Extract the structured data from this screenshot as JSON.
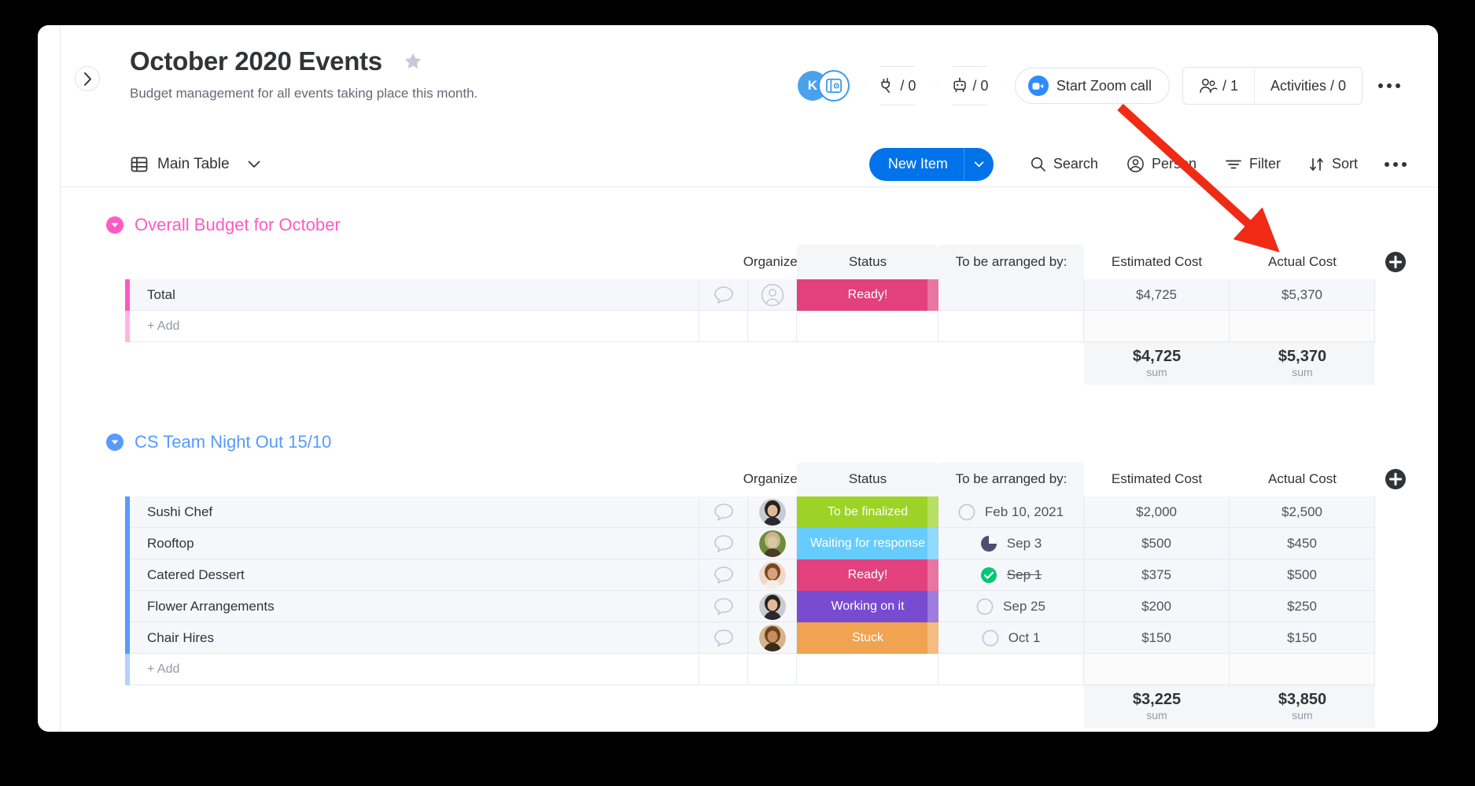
{
  "window": {
    "board_title": "October 2020 Events",
    "board_description": "Budget management for all events taking place this month.",
    "sidebar_toggle": "›"
  },
  "top_actions": {
    "avatar_initial": "K",
    "integrations_count": "/ 0",
    "automations_count": "/ 0",
    "zoom_call_label": "Start Zoom call",
    "people_count": "/ 1",
    "activities_label": "Activities / 0"
  },
  "toolbar": {
    "view_label": "Main Table",
    "new_item_label": "New Item",
    "search_label": "Search",
    "person_label": "Person",
    "filter_label": "Filter",
    "sort_label": "Sort"
  },
  "columns": {
    "name": "",
    "organizer": "Organizer",
    "status": "Status",
    "date": "To be arranged by:",
    "estimated": "Estimated Cost",
    "actual": "Actual Cost"
  },
  "add_row_label": "+ Add",
  "sum_label": "sum",
  "status_colors": {
    "ready": "#e2417e",
    "to_be_finalized": "#9cd326",
    "waiting_for_response": "#66ccff",
    "working_on_it": "#784bd1",
    "stuck": "#f0a350"
  },
  "groups": [
    {
      "name": "Overall Budget for October",
      "color": "#ff5ac4",
      "rows": [
        {
          "name": "Total",
          "organizer": "",
          "status": "Ready!",
          "status_key": "ready",
          "date": "",
          "date_state": "none",
          "estimated": "$4,725",
          "actual": "$5,370"
        }
      ],
      "sum_estimated": "$4,725",
      "sum_actual": "$5,370"
    },
    {
      "name": "CS Team Night Out 15/10",
      "color": "#579bfc",
      "rows": [
        {
          "name": "Sushi Chef",
          "organizer": "woman-dark-hair",
          "status": "To be finalized",
          "status_key": "to_be_finalized",
          "date": "Feb 10, 2021",
          "date_state": "empty",
          "estimated": "$2,000",
          "actual": "$2,500"
        },
        {
          "name": "Rooftop",
          "organizer": "pug-dog",
          "status": "Waiting for response",
          "status_key": "waiting_for_response",
          "date": "Sep 3",
          "date_state": "partial",
          "estimated": "$500",
          "actual": "$450"
        },
        {
          "name": "Catered Dessert",
          "organizer": "woman-curly-hair",
          "status": "Ready!",
          "status_key": "ready",
          "date": "Sep 1",
          "date_state": "done",
          "estimated": "$375",
          "actual": "$500"
        },
        {
          "name": "Flower Arrangements",
          "organizer": "woman-dark-hair",
          "status": "Working on it",
          "status_key": "working_on_it",
          "date": "Sep 25",
          "date_state": "empty",
          "estimated": "$200",
          "actual": "$250"
        },
        {
          "name": "Chair Hires",
          "organizer": "woman-blonde-curls",
          "status": "Stuck",
          "status_key": "stuck",
          "date": "Oct 1",
          "date_state": "empty",
          "estimated": "$150",
          "actual": "$150"
        }
      ],
      "sum_estimated": "$3,225",
      "sum_actual": "$3,850"
    }
  ],
  "annotation": {
    "arrow_color": "#ef2b16"
  }
}
